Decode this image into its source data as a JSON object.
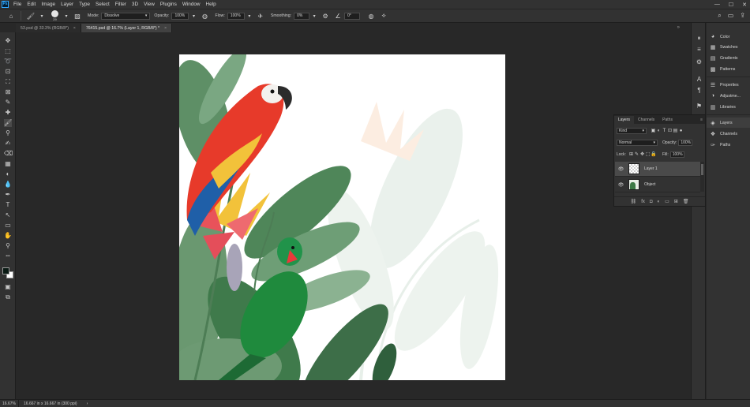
{
  "app": {
    "logo_text": "Ps"
  },
  "menu": [
    "File",
    "Edit",
    "Image",
    "Layer",
    "Type",
    "Select",
    "Filter",
    "3D",
    "View",
    "Plugins",
    "Window",
    "Help"
  ],
  "window_controls": {
    "minimize": "—",
    "maximize": "☐",
    "close": "✕"
  },
  "options": {
    "brush_size": "29",
    "mode_label": "Mode:",
    "mode_value": "Dissolve",
    "opacity_label": "Opacity:",
    "opacity_value": "100%",
    "flow_label": "Flow:",
    "flow_value": "100%",
    "smoothing_label": "Smoothing:",
    "smoothing_value": "0%",
    "angle_value": "0°"
  },
  "tabs": [
    {
      "label": "53.psd @ 33.3% (RGB/8*)",
      "close": "×"
    },
    {
      "label": "76415.psd @ 16.7% (Layer 1, RGB/8*) *",
      "close": "×"
    }
  ],
  "tabbar_overflow": "»",
  "icons": {
    "home": "⌂",
    "brush": "🖌",
    "chevron": "▾",
    "toggle_panel": "▨",
    "pressure_opacity": "◍",
    "airbrush": "✈",
    "pressure_size": "◍",
    "gear": "⚙",
    "angle": "∠",
    "symmetry": "⟡",
    "search": "⌕",
    "workspace": "▭",
    "share": "⇪"
  },
  "tools": [
    "✥",
    "⬚",
    "➰",
    "⊡",
    "⛶",
    "⊠",
    "✎",
    "✚",
    "🖌",
    "⚲",
    "✍",
    "⌫",
    "▦",
    "◐",
    "💧",
    "✒",
    "T",
    "↖",
    "▭",
    "✋",
    "⚲",
    "•••"
  ],
  "tool_bottom": [
    "▣",
    "⧉"
  ],
  "dock_icons": [
    "⏸",
    "≡",
    "⚙",
    "A",
    "¶",
    "⚑"
  ],
  "panels": [
    {
      "label": "Color",
      "icon": "◕"
    },
    {
      "label": "Swatches",
      "icon": "▦"
    },
    {
      "label": "Gradients",
      "icon": "▤"
    },
    {
      "label": "Patterns",
      "icon": "▩"
    },
    {
      "label": "Properties",
      "icon": "☰"
    },
    {
      "label": "Adjustme...",
      "icon": "◑"
    },
    {
      "label": "Libraries",
      "icon": "▥"
    },
    {
      "label": "Layers",
      "icon": "◈"
    },
    {
      "label": "Channels",
      "icon": "❖"
    },
    {
      "label": "Paths",
      "icon": "✑"
    }
  ],
  "layers_panel": {
    "tabs": [
      "Layers",
      "Channels",
      "Paths"
    ],
    "tab_icons": "≡",
    "filter_kind": "Kind",
    "filter_icons": [
      "▣",
      "◐",
      "T",
      "⊡",
      "▤",
      "●"
    ],
    "blend_mode": "Normal",
    "opacity_label": "Opacity:",
    "opacity_value": "100%",
    "lock_label": "Lock:",
    "lock_icons": [
      "⊞",
      "✎",
      "✥",
      "⬚",
      "🔒"
    ],
    "fill_label": "Fill:",
    "fill_value": "100%",
    "layers": [
      {
        "name": "Layer 1",
        "visible_icon": "👁",
        "selected": true
      },
      {
        "name": "Object",
        "visible_icon": "👁",
        "selected": false
      }
    ],
    "bottom_icons": [
      "⛓",
      "fx",
      "◘",
      "◐",
      "▭",
      "⊞",
      "🗑"
    ]
  },
  "status": {
    "zoom": "16.67%",
    "info": "16.667 in x 16.667 in (300 ppi)",
    "arrow": "›"
  }
}
